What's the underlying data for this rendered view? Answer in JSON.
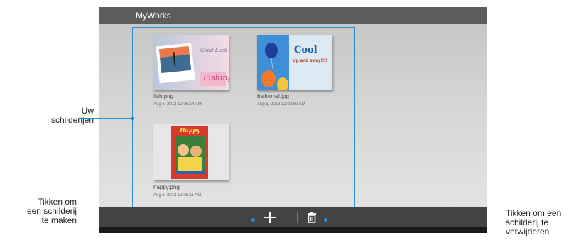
{
  "app": {
    "title": "MyWorks"
  },
  "files": [
    {
      "name": "fish.png",
      "date": "Aug 5, 2013 12:06:14 AM",
      "thumb_text": [
        "Good Luck",
        "Fishing"
      ]
    },
    {
      "name": "balloons!.jpg",
      "date": "Aug 5, 2013 12:03:50 AM",
      "thumb_text": [
        "Cool",
        "Up and away!!!!"
      ]
    },
    {
      "name": "happy.png",
      "date": "Aug 5, 2013 12:05:11 AM",
      "thumb_text": [
        "Happy"
      ]
    }
  ],
  "toolbar": {
    "add_icon": "plus-icon",
    "delete_icon": "trash-icon"
  },
  "callouts": {
    "paintings": [
      "Uw",
      "schilderijen"
    ],
    "create": [
      "Tikken om",
      "een schilderij",
      "te maken"
    ],
    "delete": [
      "Tikken om een",
      "schilderij te",
      "verwijderen"
    ]
  },
  "colors": {
    "accent": "#2a8fd0",
    "titlebar": "#5c5c5c",
    "bottombar": "#434343"
  }
}
